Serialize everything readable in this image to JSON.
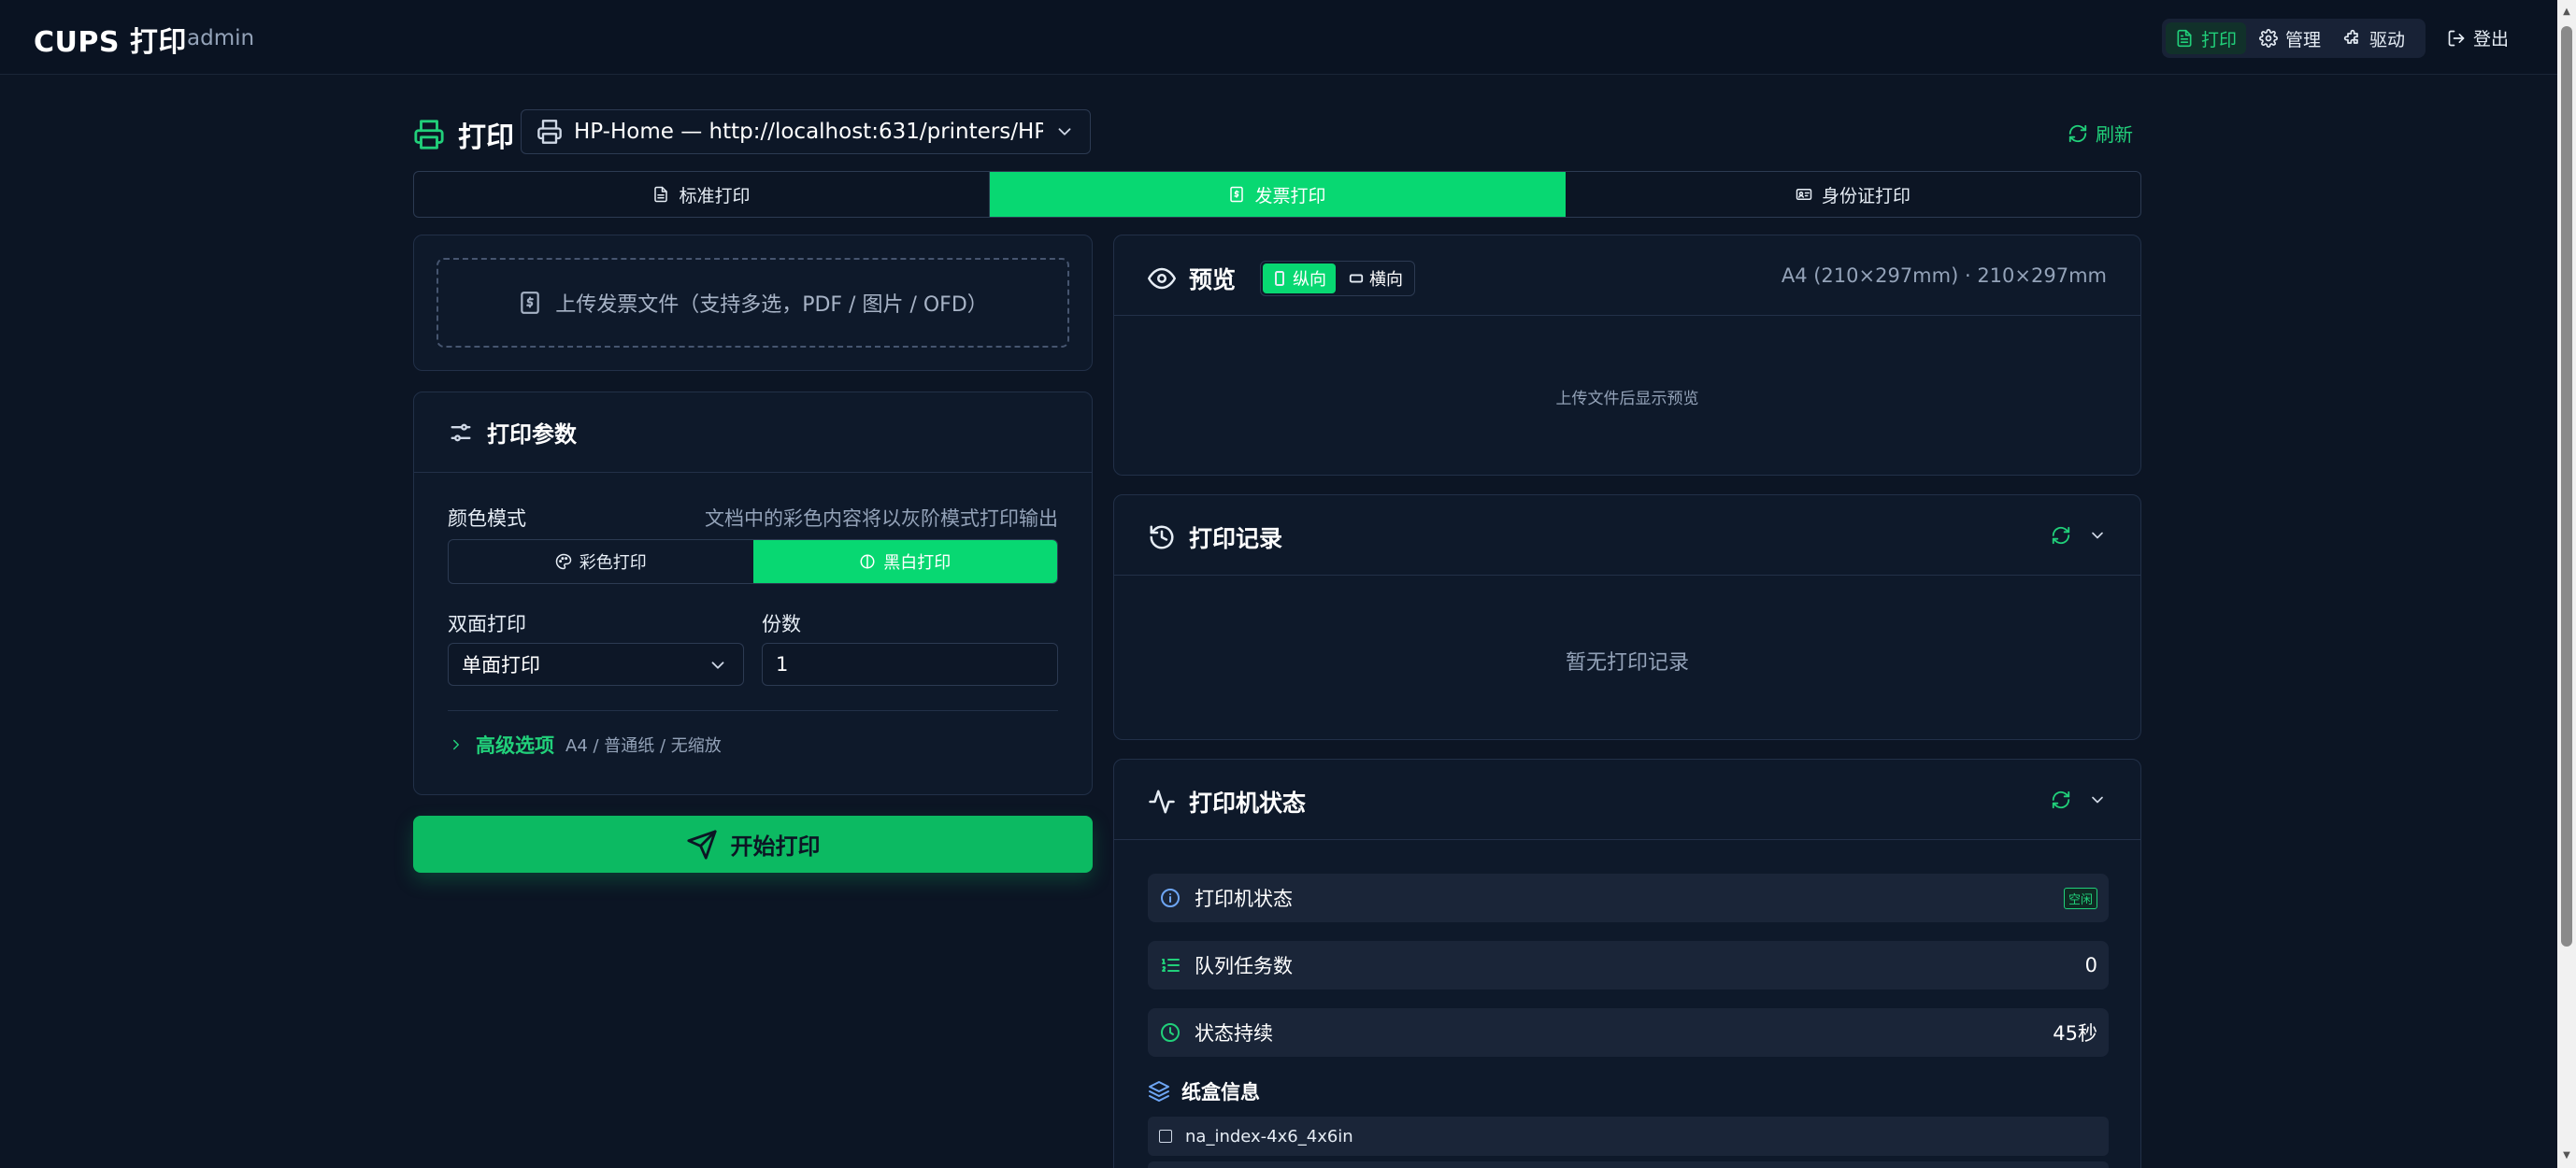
{
  "header": {
    "brand": "CUPS 打印",
    "user": "admin",
    "nav": [
      {
        "label": "打印",
        "icon": "file-text-icon",
        "active": true
      },
      {
        "label": "管理",
        "icon": "gear-icon",
        "active": false
      },
      {
        "label": "驱动",
        "icon": "puzzle-icon",
        "active": false
      }
    ],
    "logout": "登出"
  },
  "print": {
    "title": "打印",
    "printer_value": "HP-Home — http://localhost:631/printers/HP-Ho···",
    "refresh": "刷新"
  },
  "tabs": [
    {
      "label": "标准打印",
      "icon": "document-icon",
      "active": false
    },
    {
      "label": "发票打印",
      "icon": "invoice-icon",
      "active": true
    },
    {
      "label": "身份证打印",
      "icon": "id-card-icon",
      "active": false
    }
  ],
  "upload": {
    "label": "上传发票文件（支持多选，PDF / 图片 / OFD）"
  },
  "params": {
    "title": "打印参数",
    "color_mode_label": "颜色模式",
    "color_mode_hint": "文档中的彩色内容将以灰阶模式打印输出",
    "color_options": [
      {
        "label": "彩色打印",
        "icon": "palette-icon",
        "active": false
      },
      {
        "label": "黑白打印",
        "icon": "contrast-icon",
        "active": true
      }
    ],
    "duplex_label": "双面打印",
    "duplex_value": "单面打印",
    "copies_label": "份数",
    "copies_value": "1",
    "advanced_label": "高级选项",
    "advanced_summary": "A4 / 普通纸 / 无缩放"
  },
  "start_button": "开始打印",
  "preview": {
    "title": "预览",
    "portrait": "纵向",
    "landscape": "横向",
    "orientation": "portrait",
    "paper_info": "A4 (210×297mm) · 210×297mm",
    "empty": "上传文件后显示预览"
  },
  "history": {
    "title": "打印记录",
    "empty": "暂无打印记录"
  },
  "status": {
    "title": "打印机状态",
    "rows": [
      {
        "label": "打印机状态",
        "value": "空闲",
        "icon": "info-icon"
      },
      {
        "label": "队列任务数",
        "value": "0",
        "icon": "list-ordered-icon"
      },
      {
        "label": "状态持续",
        "value": "45秒",
        "icon": "clock-icon"
      }
    ],
    "tray_title": "纸盒信息",
    "trays": [
      "na_index-4x6_4x6in"
    ]
  },
  "colors": {
    "accent": "#08d872",
    "accent_text": "#21d07a",
    "background": "#0c1524",
    "card": "#0e192a",
    "border": "#223048"
  }
}
